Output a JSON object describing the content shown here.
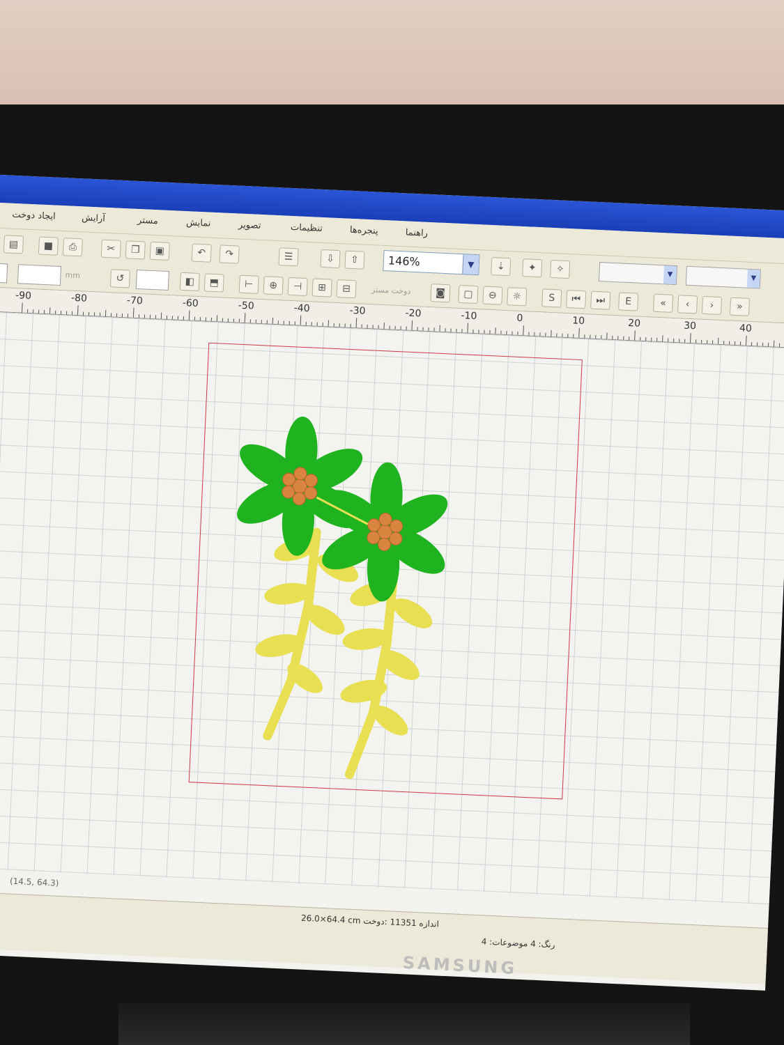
{
  "menubar": {
    "items": [
      "ایجاد دوخت",
      "آرایش",
      "مستر",
      "نمایش",
      "تصویر",
      "تنظیمات",
      "پنجره‌ها",
      "راهنما"
    ]
  },
  "toolbar": {
    "zoom_value": "146%",
    "unit_label": "mm",
    "disabled_label": "دوخت مستر"
  },
  "playback": {
    "start_label": "S",
    "end_label": "E"
  },
  "ruler": {
    "labels": [
      "-90",
      "-80",
      "-70",
      "-60",
      "-50",
      "-40",
      "-30",
      "-20",
      "-10",
      "0",
      "10",
      "20",
      "30",
      "40"
    ]
  },
  "status": {
    "coordinates": "(14.5, 64.3)",
    "dimensions": "26.0×64.4 cm   اندازه  11351 :دوخت",
    "colors": "رنگ: 4   موضوعات: 4"
  },
  "monitor": {
    "brand": "SAMSUNG"
  },
  "colors": {
    "hoop_border": "#d0394a",
    "flower_petal": "#1fb31f",
    "flower_center": "#d9843f",
    "stem_leaf": "#e8df52"
  }
}
